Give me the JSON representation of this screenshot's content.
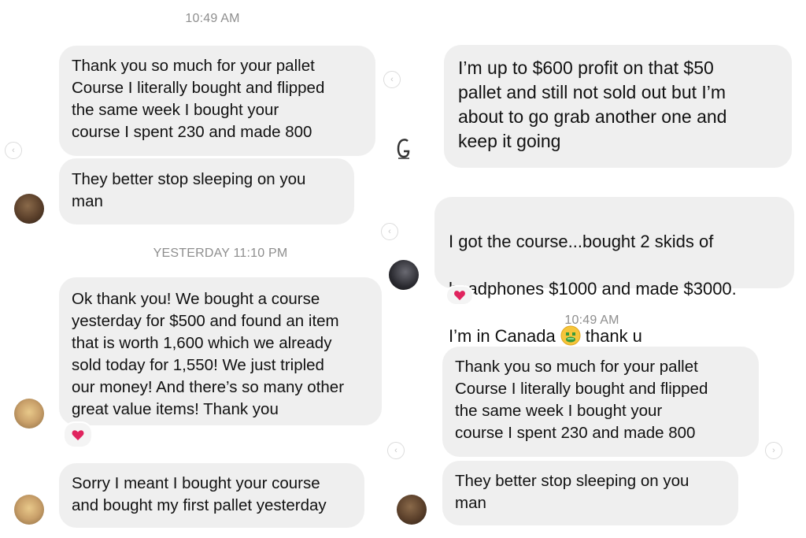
{
  "left": {
    "timestamp_top": "10:49 AM",
    "msg1": "Thank you so much for your pallet\nCourse I literally bought and flipped\nthe same week I bought your\ncourse I spent 230 and made 800",
    "msg2": "They better stop sleeping on you\nman",
    "timestamp_mid": "YESTERDAY 11:10 PM",
    "msg3": "Ok thank you! We bought a course\nyesterday for $500 and found an item\nthat is worth 1,600 which we already\nsold today for 1,550! We just tripled\nour money! And there’s so many other\ngreat value items! Thank you",
    "msg4": "Sorry I meant I bought your course\nand bought my first pallet yesterday"
  },
  "right": {
    "msg1": "I’m up to $600 profit on that $50\npallet and still not sold out but I’m\nabout to go grab another one and\nkeep it going",
    "msg2_lines": [
      "I got the course...bought 2 skids of",
      "headphones $1000 and made $3000.",
      "I’m in Canada",
      "thank u"
    ],
    "timestamp": "10:49 AM",
    "msg3": "Thank you so much for your pallet\nCourse I literally bought and flipped\nthe same week I bought your\ncourse I spent 230 and made 800",
    "msg4": "They better stop sleeping on you\nman"
  },
  "icons": {
    "reply": "reply-arrow-icon",
    "heart": "red-heart-icon",
    "money_face": "money-mouth-face-emoji"
  },
  "colors": {
    "bubble": "#efefef",
    "timestamp": "#8e8e8e",
    "heart": "#e0245e"
  }
}
